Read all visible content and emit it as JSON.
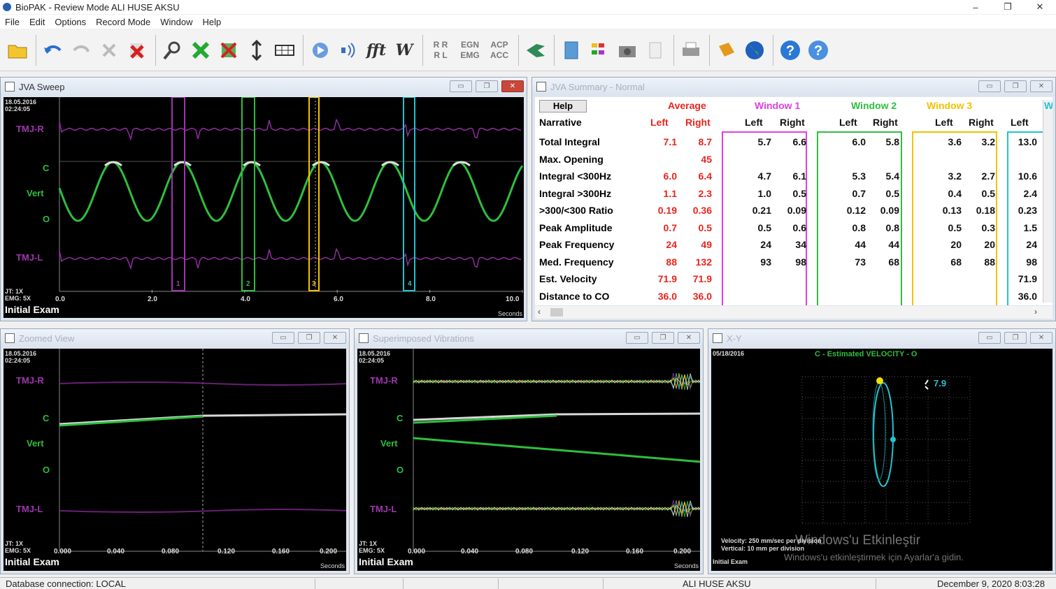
{
  "window": {
    "title": "BioPAK - Review Mode    ALI HUSE  AKSU",
    "minimize": "–",
    "maximize": "❐",
    "close": "✕"
  },
  "menu": [
    "File",
    "Edit",
    "Options",
    "Record Mode",
    "Window",
    "Help"
  ],
  "toolbar": {
    "fft": "fft",
    "w": "W",
    "rl_top": "R R",
    "rl_bottom": "R L",
    "egn": "EGN",
    "emg": "EMG",
    "acp": "ACP",
    "acc": "ACC"
  },
  "colors": {
    "purple": "#a035b0",
    "green": "#2fbf3c",
    "cyan": "#23c3d0",
    "red": "#e8241c",
    "magenta": "#e040e0",
    "yellow": "#f2c200",
    "white": "#e0e0e0"
  },
  "jva_sweep": {
    "title": "JVA Sweep",
    "date": "18.05.2016",
    "time": "02:24:05",
    "labels": {
      "tmj_r": "TMJ-R",
      "c": "C",
      "vert": "Vert",
      "o": "O",
      "tmj_l": "TMJ-L"
    },
    "jt": "JT: 1X",
    "emg": "EMG: 5X",
    "exam": "Initial Exam",
    "units": "Seconds",
    "ticks": [
      "0.0",
      "2.0",
      "4.0",
      "6.0",
      "8.0",
      "10.0"
    ],
    "window_marks": [
      "1",
      "2",
      "3",
      "4"
    ]
  },
  "jva_summary": {
    "title": "JVA Summary - Normal",
    "help": "Help",
    "narrative": "Narrative",
    "groups": [
      {
        "name": "Average",
        "color": "#e8241c"
      },
      {
        "name": "Window 1",
        "color": "#e040e0"
      },
      {
        "name": "Window 2",
        "color": "#2fbf3c"
      },
      {
        "name": "Window 3",
        "color": "#f2c200"
      },
      {
        "name": "W",
        "color": "#23c3d0"
      }
    ],
    "subheaders": [
      "Left",
      "Right",
      "Left",
      "Right",
      "Left",
      "Right",
      "Left",
      "Right",
      "Left"
    ],
    "rows": [
      {
        "label": "Total Integral",
        "values": [
          "7.1",
          "8.7",
          "5.7",
          "6.6",
          "6.0",
          "5.8",
          "3.6",
          "3.2",
          "13.0"
        ]
      },
      {
        "label": "Max. Opening",
        "values": [
          "",
          "45",
          "",
          "",
          "",
          "",
          "",
          "",
          ""
        ]
      },
      {
        "label": "Integral <300Hz",
        "values": [
          "6.0",
          "6.4",
          "4.7",
          "6.1",
          "5.3",
          "5.4",
          "3.2",
          "2.7",
          "10.6"
        ]
      },
      {
        "label": "Integral >300Hz",
        "values": [
          "1.1",
          "2.3",
          "1.0",
          "0.5",
          "0.7",
          "0.5",
          "0.4",
          "0.5",
          "2.4"
        ]
      },
      {
        "label": ">300/<300 Ratio",
        "values": [
          "0.19",
          "0.36",
          "0.21",
          "0.09",
          "0.12",
          "0.09",
          "0.13",
          "0.18",
          "0.23"
        ]
      },
      {
        "label": "Peak Amplitude",
        "values": [
          "0.7",
          "0.5",
          "0.5",
          "0.6",
          "0.8",
          "0.8",
          "0.5",
          "0.3",
          "1.5"
        ]
      },
      {
        "label": "Peak Frequency",
        "values": [
          "24",
          "49",
          "24",
          "34",
          "44",
          "44",
          "20",
          "20",
          "24"
        ]
      },
      {
        "label": "Med. Frequency",
        "values": [
          "88",
          "132",
          "93",
          "98",
          "73",
          "68",
          "68",
          "88",
          "98"
        ]
      },
      {
        "label": "Est. Velocity",
        "values": [
          "71.9",
          "71.9",
          "",
          "",
          "",
          "",
          "",
          "",
          "71.9"
        ]
      },
      {
        "label": "Distance to CO",
        "values": [
          "36.0",
          "36.0",
          "",
          "",
          "",
          "",
          "",
          "",
          "36.0"
        ]
      }
    ]
  },
  "zoomed_view": {
    "title": "Zoomed View",
    "date": "18.05.2016",
    "time": "02:24:05",
    "labels": {
      "tmj_r": "TMJ-R",
      "c": "C",
      "vert": "Vert",
      "o": "O",
      "tmj_l": "TMJ-L"
    },
    "jt": "JT: 1X",
    "emg": "EMG: 5X",
    "exam": "Initial Exam",
    "units": "Seconds",
    "ticks": [
      "0.000",
      "0.040",
      "0.080",
      "0.120",
      "0.160",
      "0.200"
    ]
  },
  "superimposed": {
    "title": "Superimposed Vibrations",
    "date": "18.05.2016",
    "time": "02:24:05",
    "labels": {
      "tmj_r": "TMJ-R",
      "c": "C",
      "vert": "Vert",
      "o": "O",
      "tmj_l": "TMJ-L"
    },
    "jt": "JT: 1X",
    "emg": "EMG: 5X",
    "exam": "Initial Exam",
    "units": "Seconds",
    "ticks": [
      "0.000",
      "0.040",
      "0.080",
      "0.120",
      "0.160",
      "0.200"
    ]
  },
  "xy": {
    "title": "X-Y",
    "date": "05/18/2016",
    "chart_title": "C - Estimated VELOCITY - O",
    "velocity_value": "7.9",
    "velocity_label": "Velocity: 250 mm/sec per division",
    "vertical_label": "Vertical: 10 mm per division",
    "exam": "Initial Exam",
    "watermark_1": "Windows'u Etkinleştir",
    "watermark_2": "Windows'u etkinleştirmek için Ayarlar'a gidin."
  },
  "statusbar": {
    "db": "Database connection: LOCAL",
    "patient": "ALI HUSE  AKSU",
    "datetime": "December 9, 2020 8:03:28"
  }
}
